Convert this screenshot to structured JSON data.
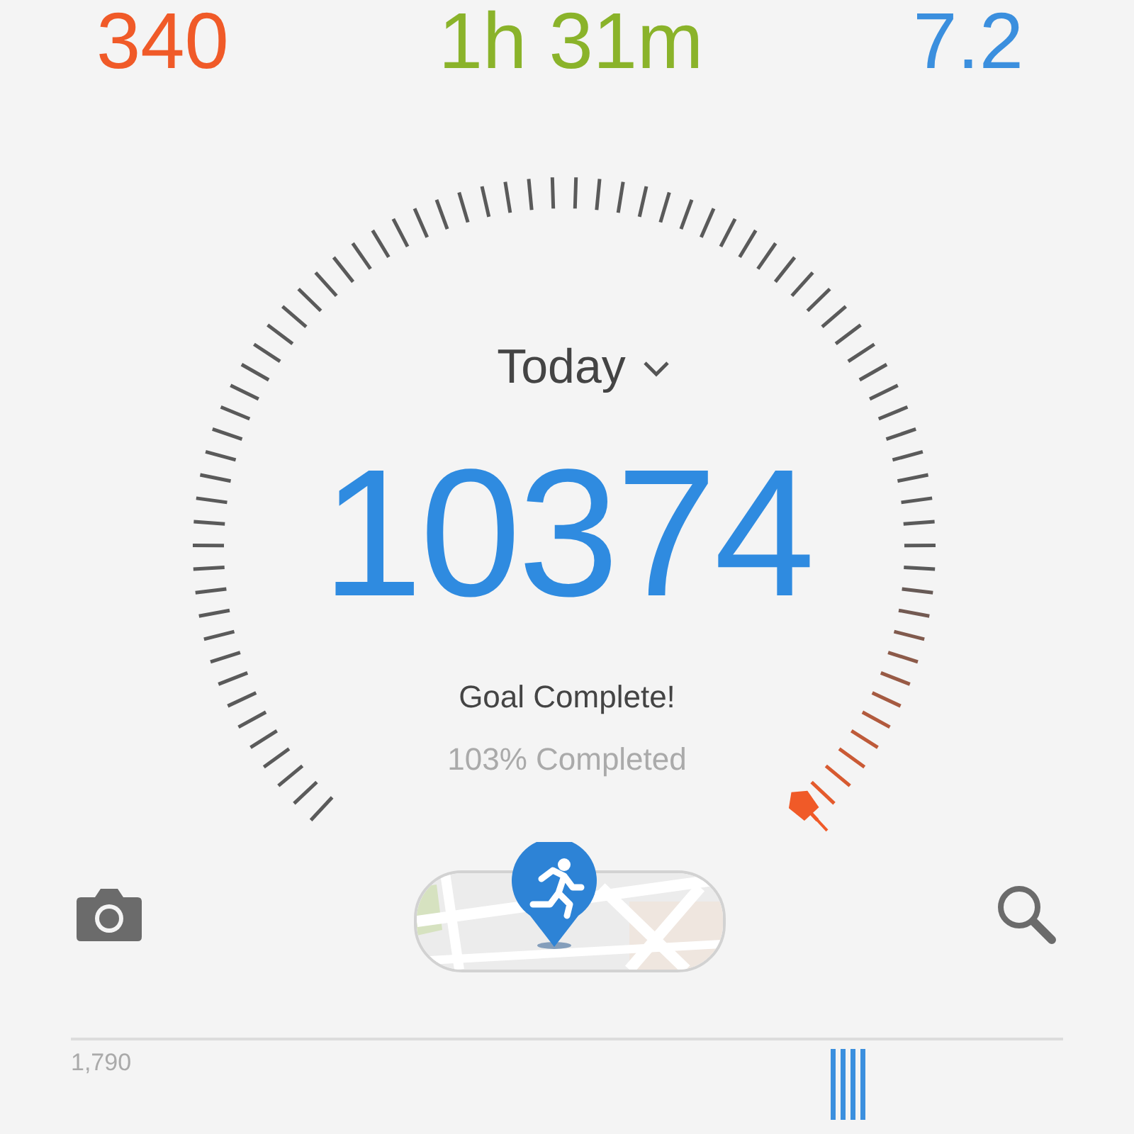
{
  "stats": [
    {
      "value": "340",
      "color": "#f05a28"
    },
    {
      "value": "1h 31m",
      "color": "#8ab32a"
    },
    {
      "value": "7.2",
      "color": "#3b8fde"
    }
  ],
  "gauge": {
    "period": "Today",
    "steps": "10374",
    "status": "Goal Complete!",
    "percent": "103% Completed"
  },
  "chart": {
    "label": "1,790"
  }
}
